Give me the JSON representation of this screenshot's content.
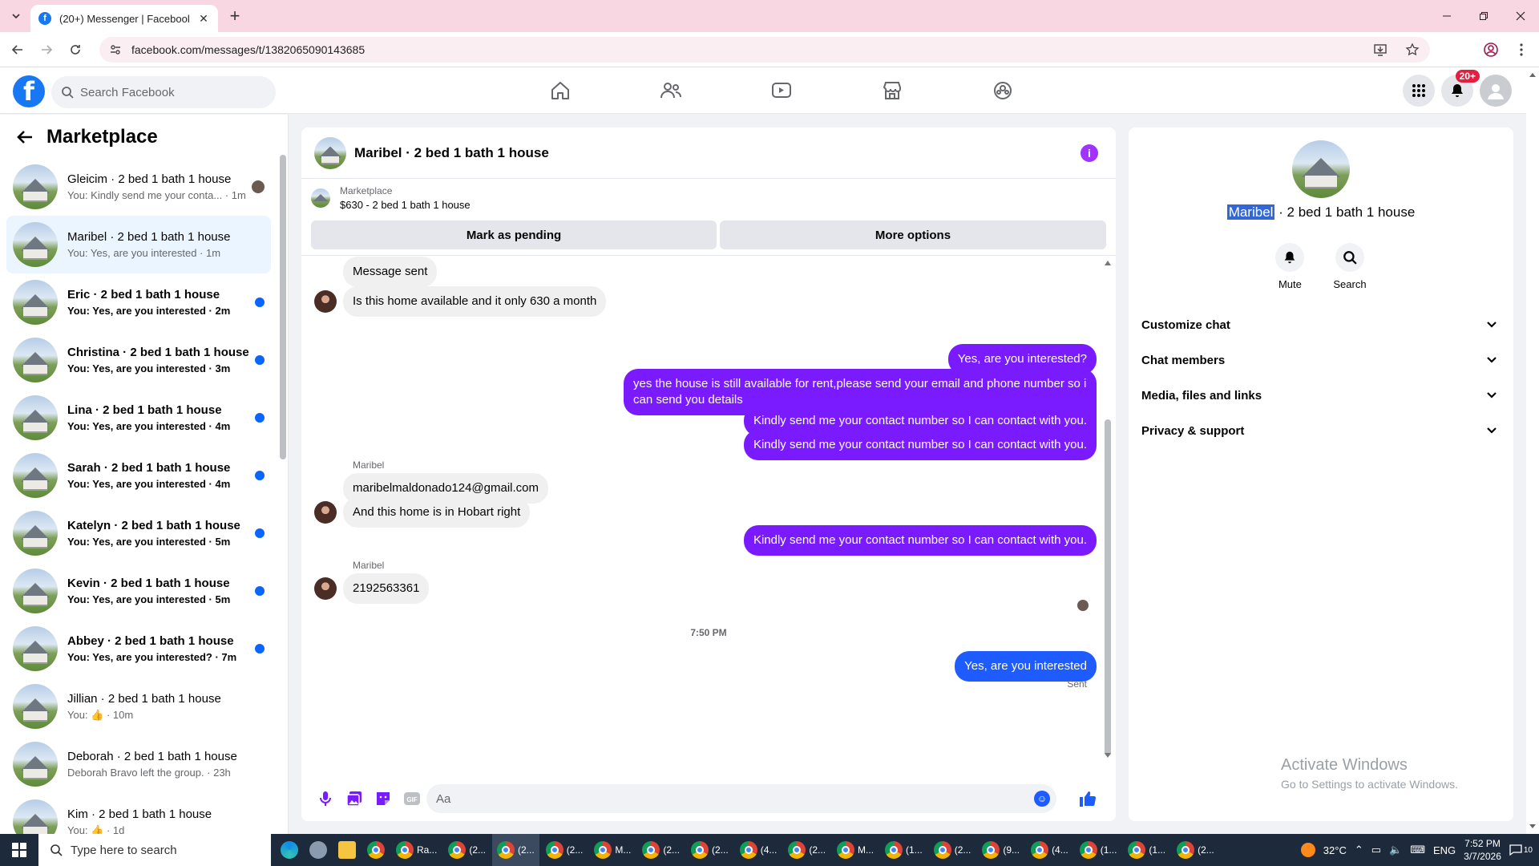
{
  "browser": {
    "tab_title": "(20+) Messenger | Facebook",
    "url": "facebook.com/messages/t/1382065090143685"
  },
  "fb": {
    "search_placeholder": "Search Facebook",
    "notification_badge": "20+"
  },
  "sidebar": {
    "title": "Marketplace",
    "chats": [
      {
        "name": "Gleicim · 2 bed 1 bath 1 house",
        "preview": "You: Kindly send me your conta... · 1m",
        "state": "seen"
      },
      {
        "name": "Maribel · 2 bed 1 bath 1 house",
        "preview": "You: Yes, are you interested · 1m",
        "state": "active"
      },
      {
        "name": "Eric · 2 bed 1 bath 1 house",
        "preview": "You: Yes, are you interested · 2m",
        "state": "unread"
      },
      {
        "name": "Christina · 2 bed 1 bath 1 house",
        "preview": "You: Yes, are you interested · 3m",
        "state": "unread"
      },
      {
        "name": "Lina · 2 bed 1 bath 1 house",
        "preview": "You: Yes, are you interested · 4m",
        "state": "unread"
      },
      {
        "name": "Sarah · 2 bed 1 bath 1 house",
        "preview": "You: Yes, are you interested · 4m",
        "state": "unread"
      },
      {
        "name": "Katelyn · 2 bed 1 bath 1 house",
        "preview": "You: Yes, are you interested · 5m",
        "state": "unread"
      },
      {
        "name": "Kevin · 2 bed 1 bath 1 house",
        "preview": "You: Yes, are you interested · 5m",
        "state": "unread"
      },
      {
        "name": "Abbey · 2 bed 1 bath 1 house",
        "preview": "You: Yes, are you interested? · 7m",
        "state": "unread"
      },
      {
        "name": "Jillian · 2 bed 1 bath 1 house",
        "preview": "You: 👍 · 10m",
        "state": "read"
      },
      {
        "name": "Deborah · 2 bed 1 bath 1 house",
        "preview": "Deborah Bravo left the group. · 23h",
        "state": "read"
      },
      {
        "name": "Kim · 2 bed 1 bath 1 house",
        "preview": "You: 👍 · 1d",
        "state": "read"
      }
    ]
  },
  "conversation": {
    "title": "Maribel · 2 bed 1 bath 1 house",
    "marketplace_label": "Marketplace",
    "listing": "$630 - 2 bed 1 bath 1 house",
    "mark_pending_label": "Mark as pending",
    "more_options_label": "More options",
    "messages": {
      "m1": "Message sent",
      "m2": "Is this home available and it only 630 a month",
      "m3": "Yes, are you interested?",
      "m4": "yes the house is still available for rent,please send your email and phone number so i can send you details",
      "m5": "Kindly send me your contact number so I can contact with you.",
      "m6": "Kindly send me your contact number so I can contact with you.",
      "sender1": "Maribel",
      "m7": "maribelmaldonado124@gmail.com",
      "m8": "And this home is in Hobart right",
      "m9": "Kindly send me your contact number so I can contact with you.",
      "sender2": "Maribel",
      "m10": "2192563361",
      "time": "7:50 PM",
      "m11": "Yes, are you interested",
      "sent_status": "Sent"
    },
    "composer_placeholder": "Aa"
  },
  "details": {
    "name_highlight": "Maribel",
    "name_rest": " · 2 bed 1 bath 1 house",
    "mute_label": "Mute",
    "search_label": "Search",
    "menu": [
      "Customize chat",
      "Chat members",
      "Media, files and links",
      "Privacy & support"
    ],
    "watermark_title": "Activate Windows",
    "watermark_sub": "Go to Settings to activate Windows."
  },
  "taskbar": {
    "search_placeholder": "Type here to search",
    "apps": [
      "Ra...",
      "(2...",
      "(2...",
      "(2...",
      "M...",
      "(2...",
      "(2...",
      "(4...",
      "(2...",
      "M...",
      "(1...",
      "(2...",
      "(9...",
      "(4...",
      "(1...",
      "(1...",
      "(2..."
    ],
    "temperature": "32°C",
    "language": "ENG",
    "time": "7:52 PM",
    "date": "3/7/2026",
    "notifications": "10"
  },
  "colors": {
    "fb_blue": "#1877f2",
    "outgoing_bubble": "#7a1bff",
    "last_bubble": "#1f5cff",
    "unread_dot": "#0866ff"
  }
}
